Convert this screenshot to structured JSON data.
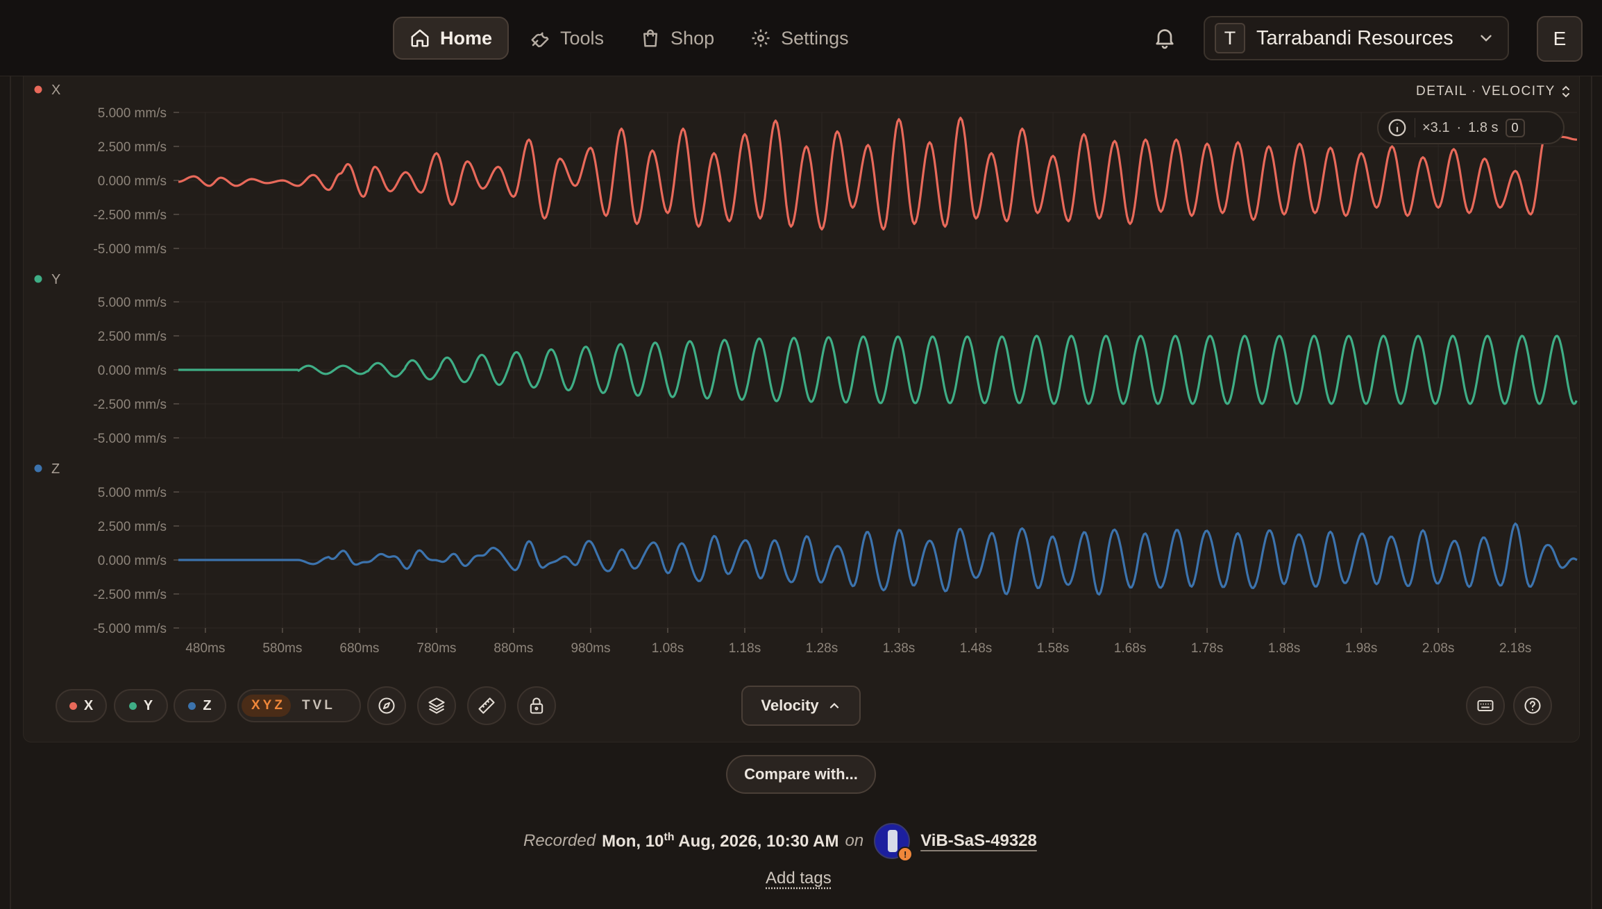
{
  "nav": {
    "items": [
      {
        "label": "Home",
        "icon": "home-icon",
        "active": true
      },
      {
        "label": "Tools",
        "icon": "wrench-icon",
        "active": false
      },
      {
        "label": "Shop",
        "icon": "shopping-bag-icon",
        "active": false
      },
      {
        "label": "Settings",
        "icon": "gear-icon",
        "active": false
      }
    ],
    "org_initial": "T",
    "org_name": "Tarrabandi Resources",
    "user_initial": "E"
  },
  "chart_header": {
    "mode_label": "DETAIL · VELOCITY",
    "zoom": "×3.1",
    "separator": "·",
    "window": "1.8 s",
    "zero_label": "0"
  },
  "colors": {
    "x": "#e8695a",
    "y": "#3fae86",
    "z": "#3c73ad",
    "accent": "#f0873a"
  },
  "chart_data": {
    "type": "line",
    "xlabel": "",
    "x_tick_labels": [
      "480ms",
      "580ms",
      "680ms",
      "780ms",
      "880ms",
      "980ms",
      "1.08s",
      "1.18s",
      "1.28s",
      "1.38s",
      "1.48s",
      "1.58s",
      "1.68s",
      "1.78s",
      "1.88s",
      "1.98s",
      "2.08s",
      "2.18s"
    ],
    "x_ticks_s": [
      0.48,
      0.58,
      0.68,
      0.78,
      0.88,
      0.98,
      1.08,
      1.18,
      1.28,
      1.38,
      1.48,
      1.58,
      1.68,
      1.78,
      1.88,
      1.98,
      2.08,
      2.18
    ],
    "xlim_s": [
      0.445,
      2.26
    ],
    "y_unit": "mm/s",
    "y_tick_labels": [
      "5.000 mm/s",
      "2.500 mm/s",
      "0.000 mm/s",
      "-2.500 mm/s",
      "-5.000 mm/s"
    ],
    "y_ticks": [
      5,
      2.5,
      0,
      -2.5,
      -5
    ],
    "ylim": [
      -5,
      5
    ],
    "series": [
      {
        "name": "X",
        "x_s": [
          0.445,
          0.465,
          0.485,
          0.5,
          0.52,
          0.54,
          0.56,
          0.58,
          0.6,
          0.62,
          0.64,
          0.655,
          0.665,
          0.685,
          0.7,
          0.72,
          0.74,
          0.76,
          0.78,
          0.8,
          0.82,
          0.84,
          0.86,
          0.88,
          0.9,
          0.92,
          0.94,
          0.96,
          0.98,
          1.0,
          1.02,
          1.04,
          1.06,
          1.08,
          1.1,
          1.12,
          1.14,
          1.16,
          1.18,
          1.2,
          1.22,
          1.24,
          1.26,
          1.28,
          1.3,
          1.32,
          1.34,
          1.36,
          1.38,
          1.4,
          1.42,
          1.44,
          1.46,
          1.48,
          1.5,
          1.52,
          1.54,
          1.56,
          1.58,
          1.6,
          1.62,
          1.64,
          1.66,
          1.68,
          1.7,
          1.72,
          1.74,
          1.76,
          1.78,
          1.8,
          1.82,
          1.84,
          1.86,
          1.88,
          1.9,
          1.92,
          1.94,
          1.96,
          1.98,
          2.0,
          2.02,
          2.04,
          2.06,
          2.08,
          2.1,
          2.12,
          2.14,
          2.16,
          2.18,
          2.2,
          2.22,
          2.24,
          2.26
        ],
        "values": [
          -0.1,
          0.3,
          -0.4,
          0.2,
          -0.4,
          0.1,
          -0.2,
          0.0,
          -0.4,
          0.4,
          -0.7,
          0.5,
          1.2,
          -1.2,
          1.0,
          -0.8,
          0.6,
          -0.9,
          2.0,
          -1.8,
          1.4,
          -0.6,
          1.0,
          -1.2,
          3.0,
          -2.8,
          1.6,
          -0.4,
          2.4,
          -2.6,
          3.8,
          -3.2,
          2.2,
          -2.4,
          3.8,
          -3.4,
          2.0,
          -3.0,
          3.4,
          -2.8,
          4.4,
          -3.4,
          2.5,
          -3.6,
          3.6,
          -2.0,
          2.6,
          -3.6,
          4.5,
          -3.2,
          2.8,
          -3.4,
          4.6,
          -2.8,
          2.0,
          -3.0,
          3.8,
          -2.4,
          1.8,
          -3.0,
          3.4,
          -2.8,
          2.9,
          -3.2,
          3.0,
          -2.3,
          3.0,
          -2.6,
          2.7,
          -2.4,
          2.8,
          -2.9,
          2.5,
          -2.5,
          2.7,
          -2.4,
          2.4,
          -2.6,
          2.0,
          -2.0,
          2.5,
          -2.6,
          1.7,
          -2.0,
          2.3,
          -2.4,
          1.6,
          -2.0,
          0.7,
          -2.5,
          3.5,
          3.2,
          3.0
        ]
      },
      {
        "name": "Y",
        "amplitude_growth": "starts ~0.600 s, reaches ~2.4 mm/s by ~1.40 s",
        "peak_times_s": [
          0.66,
          0.71,
          0.76,
          0.805,
          0.85,
          0.895,
          0.94,
          0.985,
          1.03,
          1.075,
          1.12,
          1.165,
          1.21,
          1.255,
          1.3,
          1.345,
          1.39,
          1.435,
          1.48,
          1.525,
          1.57,
          1.615,
          1.66,
          1.705,
          1.75,
          1.795,
          1.84,
          1.885,
          1.93,
          1.975,
          2.02,
          2.065,
          2.11,
          2.155,
          2.2,
          2.245
        ],
        "peak_values": [
          0.3,
          0.5,
          0.7,
          0.9,
          1.1,
          1.3,
          1.5,
          1.7,
          1.9,
          2.0,
          2.1,
          2.2,
          2.3,
          2.35,
          2.4,
          2.45,
          2.45,
          2.45,
          2.45,
          2.45,
          2.5,
          2.5,
          2.5,
          2.5,
          2.5,
          2.5,
          2.5,
          2.5,
          2.5,
          2.5,
          2.5,
          2.5,
          2.5,
          2.5,
          2.5,
          2.5
        ]
      },
      {
        "name": "Z",
        "x_s": [
          0.445,
          0.6,
          0.62,
          0.64,
          0.66,
          0.68,
          0.7,
          0.72,
          0.74,
          0.76,
          0.78,
          0.8,
          0.82,
          0.84,
          0.86,
          0.88,
          0.9,
          0.92,
          0.94,
          0.96,
          0.98,
          1.0,
          1.02,
          1.04,
          1.06,
          1.08,
          1.1,
          1.12,
          1.14,
          1.16,
          1.18,
          1.2,
          1.22,
          1.24,
          1.26,
          1.28,
          1.3,
          1.32,
          1.34,
          1.36,
          1.38,
          1.4,
          1.42,
          1.44,
          1.46,
          1.48,
          1.5,
          1.52,
          1.54,
          1.56,
          1.58,
          1.6,
          1.62,
          1.64,
          1.66,
          1.68,
          1.7,
          1.72,
          1.74,
          1.76,
          1.78,
          1.8,
          1.82,
          1.84,
          1.86,
          1.88,
          1.9,
          1.92,
          1.94,
          1.96,
          1.98,
          2.0,
          2.02,
          2.04,
          2.06,
          2.08,
          2.1,
          2.12,
          2.14,
          2.16,
          2.18,
          2.2,
          2.22,
          2.24,
          2.26
        ],
        "values": [
          0.0,
          0.0,
          -0.3,
          0.2,
          0.5,
          -0.4,
          0.2,
          0.4,
          -0.5,
          0.6,
          -0.2,
          0.3,
          -0.3,
          0.5,
          0.8,
          -0.8,
          1.2,
          -0.6,
          0.2,
          -0.2,
          1.4,
          -0.9,
          0.6,
          -0.6,
          1.4,
          -0.8,
          1.2,
          -1.7,
          1.6,
          -1.0,
          1.6,
          -1.2,
          1.4,
          -1.8,
          1.6,
          -1.6,
          1.2,
          -1.8,
          2.0,
          -2.4,
          2.1,
          -1.8,
          1.6,
          -2.2,
          2.2,
          -1.5,
          1.9,
          -2.4,
          2.5,
          -2.0,
          1.6,
          -2.0,
          2.0,
          -2.4,
          2.4,
          -2.0,
          1.8,
          -2.2,
          2.2,
          -1.8,
          2.3,
          -2.0,
          1.8,
          -2.2,
          2.2,
          -1.6,
          2.0,
          -2.0,
          1.9,
          -1.8,
          2.0,
          -1.6,
          1.8,
          -2.0,
          2.0,
          -1.8,
          1.5,
          -1.8,
          1.7,
          -2.0,
          2.5,
          -2.0,
          1.2,
          -0.4,
          0.0
        ]
      }
    ]
  },
  "toolbar": {
    "x_label": "X",
    "y_label": "Y",
    "z_label": "Z",
    "seg_xyz": "XYZ",
    "seg_tvl": "TVL",
    "velocity_label": "Velocity",
    "compare_label": "Compare with..."
  },
  "recording": {
    "prefix": "Recorded",
    "date_day": "Mon, 10",
    "date_sup": "th",
    "date_rest": "Aug, 2026, 10:30 AM",
    "on": "on",
    "device": "ViB-SaS-49328",
    "warn_glyph": "!",
    "add_tags": "Add tags"
  }
}
